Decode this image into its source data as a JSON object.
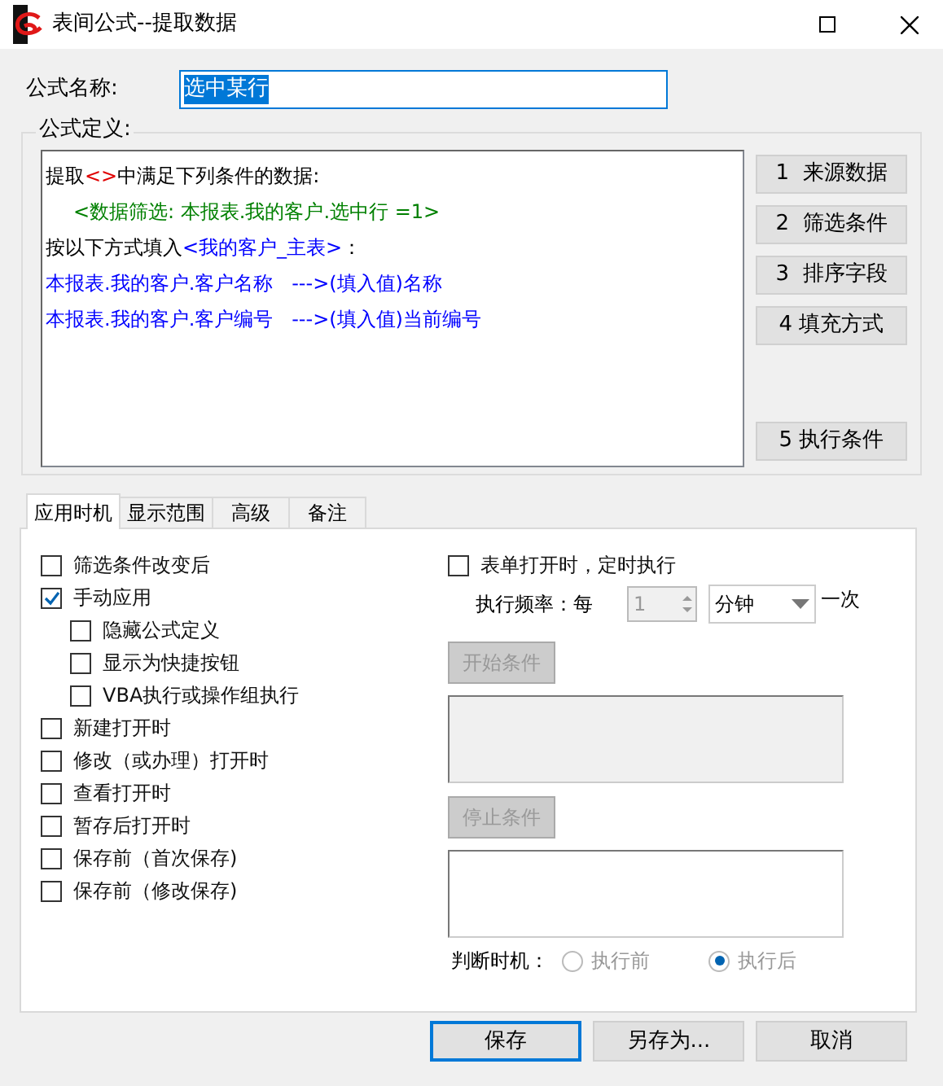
{
  "window": {
    "title": "表间公式--提取数据"
  },
  "name_field": {
    "label": "公式名称:",
    "value": "选中某行"
  },
  "definition": {
    "label": "公式定义:",
    "lines": [
      {
        "indent": false,
        "segments": [
          {
            "text": "提取",
            "color": "#000000"
          },
          {
            "text": "<>",
            "color": "#e00000"
          },
          {
            "text": "中满足下列条件的数据:",
            "color": "#000000"
          }
        ]
      },
      {
        "indent": true,
        "segments": [
          {
            "text": "<数据筛选: 本报表.我的客户.选中行 =1>",
            "color": "#008000"
          }
        ]
      },
      {
        "indent": false,
        "segments": [
          {
            "text": "按以下方式填入",
            "color": "#000000"
          },
          {
            "text": "<我的客户_主表>",
            "color": "#0000ff"
          },
          {
            "text": "：",
            "color": "#000000"
          }
        ]
      },
      {
        "indent": false,
        "segments": [
          {
            "text": "本报表.我的客户.客户名称   --->(填入值)名称",
            "color": "#0000ff"
          }
        ]
      },
      {
        "indent": false,
        "segments": [
          {
            "text": "本报表.我的客户.客户编号   --->(填入值)当前编号",
            "color": "#0000ff"
          }
        ]
      }
    ],
    "buttons": [
      "1  来源数据",
      "2  筛选条件",
      "3  排序字段",
      "4 填充方式"
    ],
    "last_button": "5 执行条件"
  },
  "tabs": [
    {
      "label": "应用时机",
      "selected": true
    },
    {
      "label": "显示范围",
      "selected": false
    },
    {
      "label": "高级",
      "selected": false
    },
    {
      "label": "备注",
      "selected": false
    }
  ],
  "options": [
    {
      "label": "筛选条件改变后",
      "checked": false
    },
    {
      "label": "手动应用",
      "checked": true,
      "children": [
        {
          "label": "隐藏公式定义",
          "checked": false
        },
        {
          "label": "显示为快捷按钮",
          "checked": false
        },
        {
          "label": "VBA执行或操作组执行",
          "checked": false
        }
      ]
    },
    {
      "label": "新建打开时",
      "checked": false
    },
    {
      "label": "修改（或办理）打开时",
      "checked": false
    },
    {
      "label": "查看打开时",
      "checked": false
    },
    {
      "label": "暂存后打开时",
      "checked": false
    },
    {
      "label": "保存前（首次保存)",
      "checked": false
    },
    {
      "label": "保存前（修改保存)",
      "checked": false
    }
  ],
  "timer": {
    "label": "表单打开时，定时执行",
    "checked": false,
    "frequency_label": "执行频率：每",
    "count": "1",
    "unit": "分钟",
    "suffix": "一次",
    "start_button": {
      "label": "开始条件",
      "disabled": true
    },
    "start_box_disabled": true,
    "stop_button": {
      "label": "停止条件",
      "disabled": true
    },
    "stop_box_disabled": false,
    "judge_label": "判断时机：",
    "radios": [
      {
        "label": "执行前",
        "selected": false
      },
      {
        "label": "执行后",
        "selected": true
      }
    ]
  },
  "footer_buttons": [
    {
      "label": "保存",
      "default": true
    },
    {
      "label": "另存为...",
      "default": false
    },
    {
      "label": "取消",
      "default": false
    }
  ]
}
